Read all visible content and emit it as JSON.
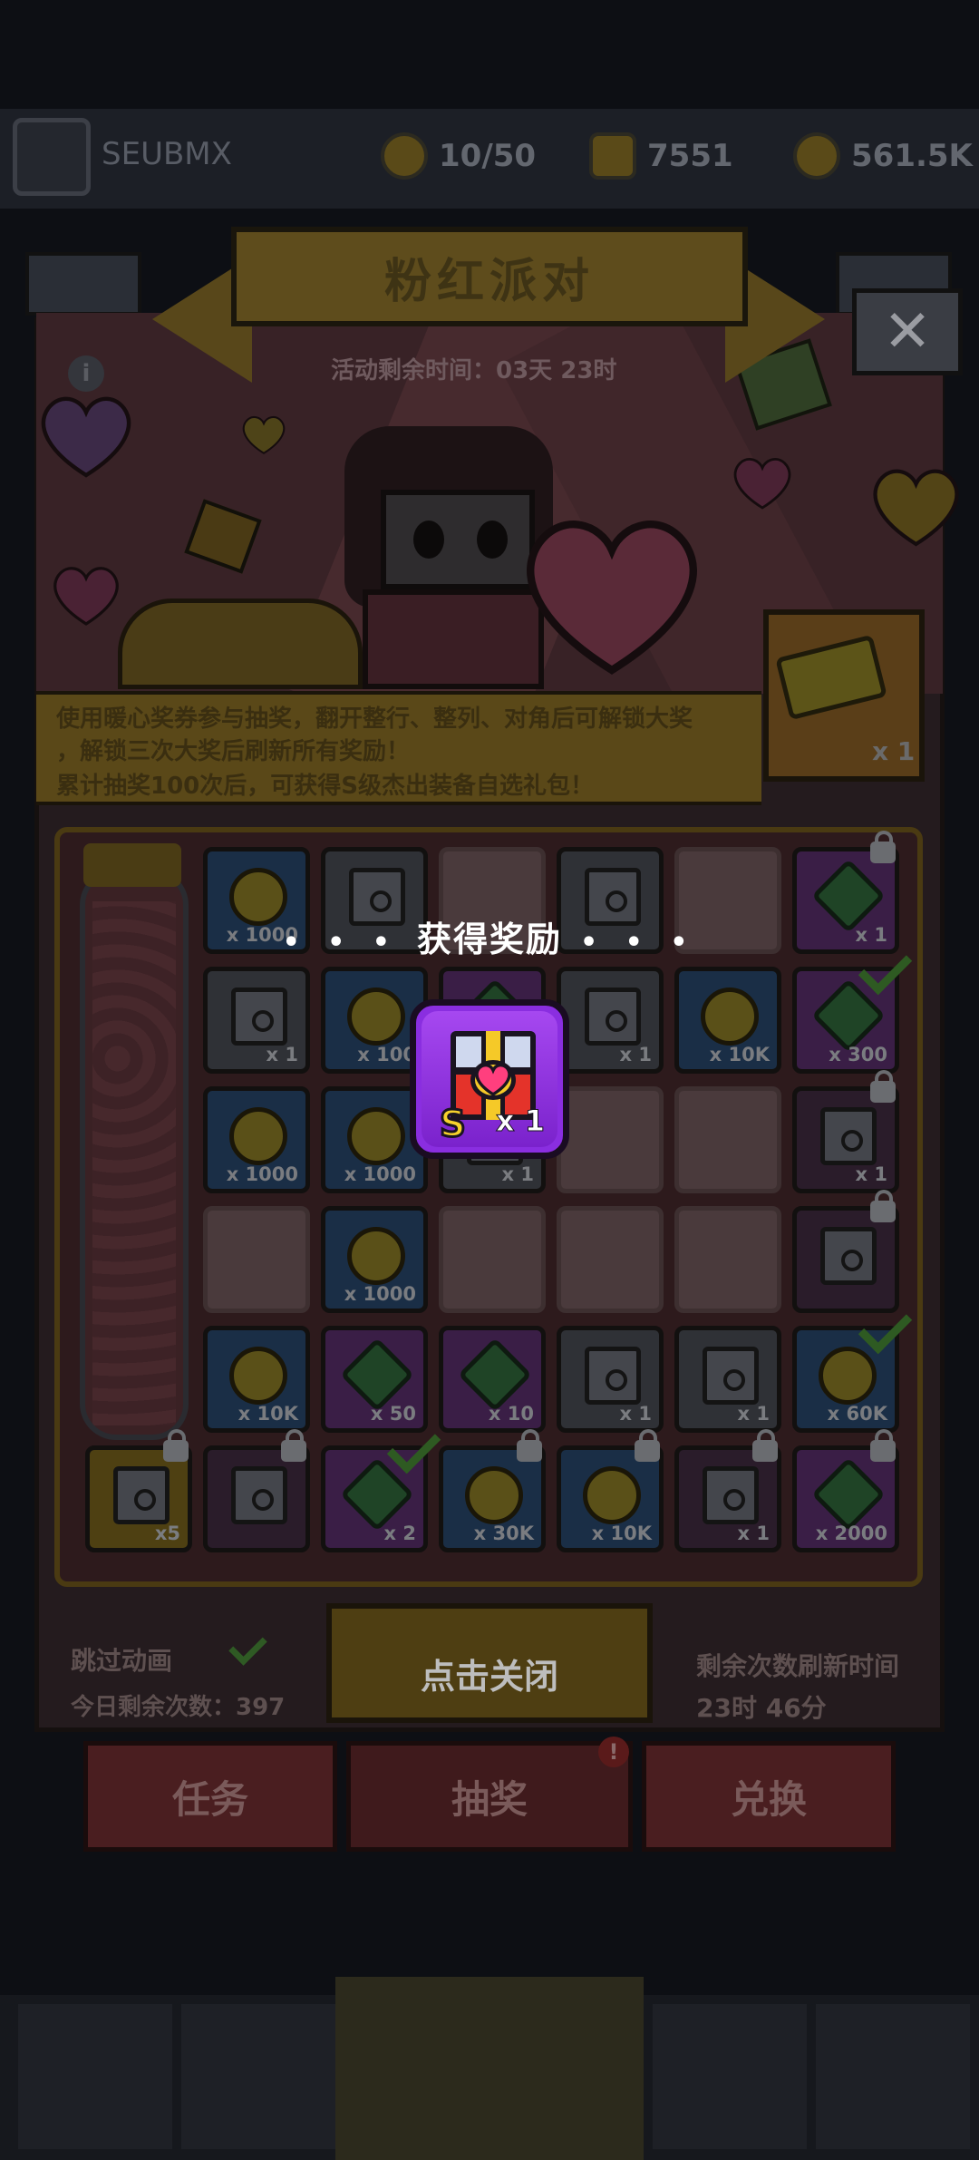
{
  "player": {
    "name": "SEUBMX",
    "level": ""
  },
  "resources": [
    {
      "icon": "energy-icon",
      "value": "10/50"
    },
    {
      "icon": "gem-icon",
      "value": "7551"
    },
    {
      "icon": "coin-icon",
      "value": "561.5K"
    }
  ],
  "event": {
    "title": "粉红派对",
    "timer": "活动剩余时间：03天 23时",
    "description": [
      "使用暖心奖券参与抽奖，翻开整行、整列、对角后可解锁大奖",
      "，解锁三次大奖后刷新所有奖励！",
      "累计抽奖100次后，可获得S级杰出装备自选礼包！"
    ],
    "ticket_count": "x 1"
  },
  "grid": {
    "rows": [
      [
        {
          "type": "coin",
          "qty": "x 1000"
        },
        {
          "type": "chest",
          "qty": ""
        },
        {
          "type": "empty",
          "qty": ""
        },
        {
          "type": "chest",
          "qty": ""
        },
        {
          "type": "empty",
          "qty": ""
        },
        {
          "type": "gem",
          "qty": "x 1",
          "lock": true
        }
      ],
      [
        {
          "type": "chest",
          "qty": "x 1"
        },
        {
          "type": "coin",
          "qty": "x 100"
        },
        {
          "type": "gem",
          "qty": ""
        },
        {
          "type": "chest",
          "qty": "x 1"
        },
        {
          "type": "coin",
          "qty": "x 10K"
        },
        {
          "type": "gem",
          "qty": "x 300",
          "check": true
        }
      ],
      [
        {
          "type": "coin",
          "qty": "x 1000"
        },
        {
          "type": "coin",
          "qty": "x 1000"
        },
        {
          "type": "chest",
          "qty": "x 1"
        },
        {
          "type": "empty",
          "qty": ""
        },
        {
          "type": "empty",
          "qty": ""
        },
        {
          "type": "dark",
          "qty": "x 1",
          "lock": true
        }
      ],
      [
        {
          "type": "empty",
          "qty": ""
        },
        {
          "type": "coin",
          "qty": "x 1000"
        },
        {
          "type": "empty",
          "qty": ""
        },
        {
          "type": "empty",
          "qty": ""
        },
        {
          "type": "empty",
          "qty": ""
        },
        {
          "type": "dark",
          "qty": "",
          "lock": true
        }
      ],
      [
        {
          "type": "coin",
          "qty": "x 10K"
        },
        {
          "type": "gem",
          "qty": "x 50"
        },
        {
          "type": "gem",
          "qty": "x 10"
        },
        {
          "type": "chest",
          "qty": "x 1"
        },
        {
          "type": "chest",
          "qty": "x 1"
        },
        {
          "type": "coin",
          "qty": "x 60K",
          "check": true
        }
      ]
    ],
    "bottom_row": [
      {
        "type": "gold",
        "qty": "x5",
        "lock": true
      },
      {
        "type": "dark",
        "qty": "",
        "lock": true
      },
      {
        "type": "gem",
        "qty": "x 2",
        "check": true
      },
      {
        "type": "coin",
        "qty": "x 30K",
        "lock": true
      },
      {
        "type": "coin",
        "qty": "x 10K",
        "lock": true
      },
      {
        "type": "dark",
        "qty": "x 1",
        "lock": true
      },
      {
        "type": "gem",
        "qty": "x 2000",
        "lock": true
      }
    ]
  },
  "controls": {
    "skip_animation": "跳过动画",
    "remaining_today": "今日剩余次数：397",
    "refresh_label": "剩余次数刷新时间",
    "refresh_time": "23时 46分"
  },
  "tabs": [
    {
      "label": "任务"
    },
    {
      "label": "抽奖",
      "badge": "!"
    },
    {
      "label": "兑换"
    }
  ],
  "popup": {
    "title": "获得奖励",
    "dots": "• • •",
    "reward": {
      "grade": "S",
      "qty": "x 1",
      "icon": "heart-chest-icon"
    },
    "close_tip": "点击关闭"
  }
}
